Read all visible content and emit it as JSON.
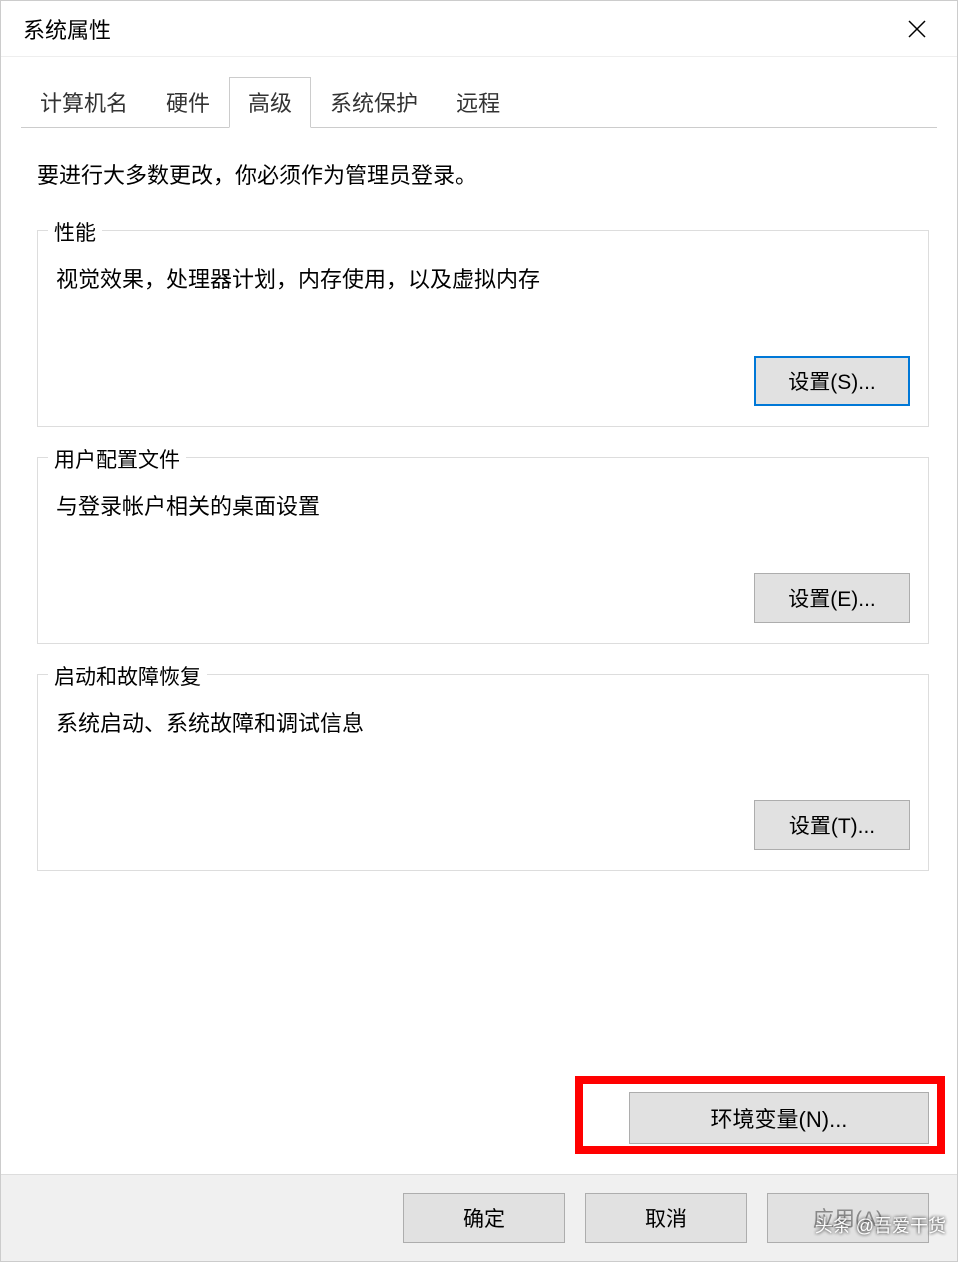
{
  "window": {
    "title": "系统属性"
  },
  "tabs": {
    "computer_name": "计算机名",
    "hardware": "硬件",
    "advanced": "高级",
    "system_protection": "系统保护",
    "remote": "远程"
  },
  "content": {
    "admin_note": "要进行大多数更改，你必须作为管理员登录。",
    "performance": {
      "legend": "性能",
      "description": "视觉效果，处理器计划，内存使用，以及虚拟内存",
      "button": "设置(S)..."
    },
    "user_profile": {
      "legend": "用户配置文件",
      "description": "与登录帐户相关的桌面设置",
      "button": "设置(E)..."
    },
    "startup": {
      "legend": "启动和故障恢复",
      "description": "系统启动、系统故障和调试信息",
      "button": "设置(T)..."
    },
    "env_var_button": "环境变量(N)..."
  },
  "footer": {
    "ok": "确定",
    "cancel": "取消",
    "apply": "应用(A)"
  },
  "watermark": "头条 @吾爱干货"
}
